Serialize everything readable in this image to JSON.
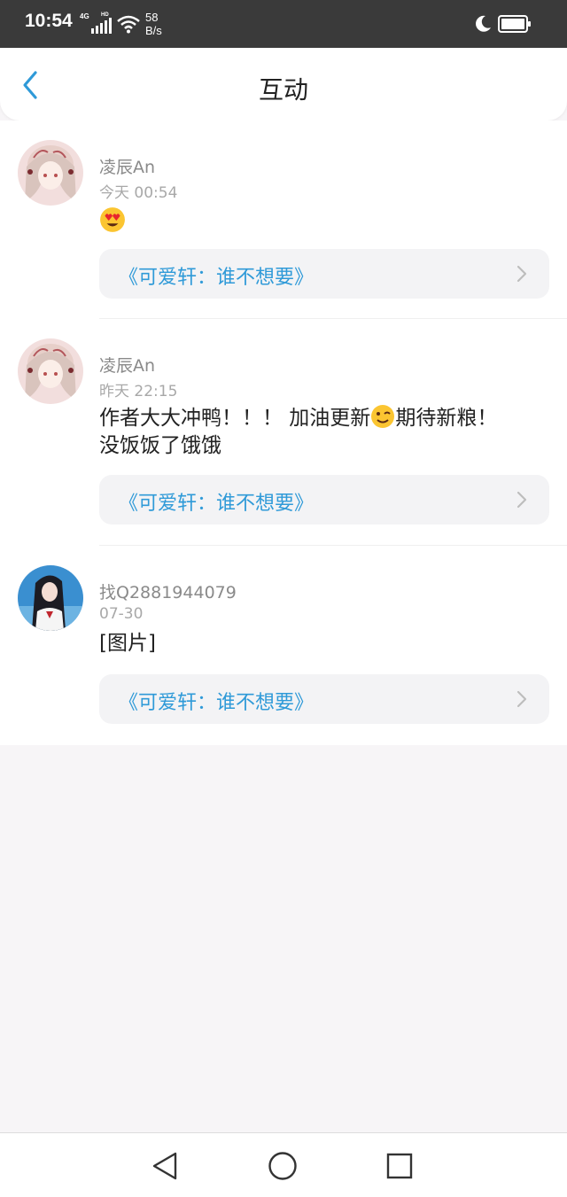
{
  "status_bar": {
    "time": "10:54",
    "network": "4G",
    "hd": "HD",
    "speed_value": "58",
    "speed_unit": "B/s"
  },
  "header": {
    "title": "互动"
  },
  "interactions": [
    {
      "username": "凌辰An",
      "time": "今天 00:54",
      "content_emoji": "heart-eyes-emoji",
      "work_title": "《可爱轩：谁不想要》"
    },
    {
      "username": "凌辰An",
      "time": "昨天 22:15",
      "content_line1_a": "作者大大冲鸭！！！ 加油更新",
      "content_emoji": "wink-emoji",
      "content_line1_b": "期待新粮！",
      "content_line2": "没饭饭了饿饿",
      "work_title": "《可爱轩：谁不想要》"
    },
    {
      "username": "找Q2881944079",
      "time": "07-30",
      "content": "[图片]",
      "work_title": "《可爱轩：谁不想要》"
    }
  ],
  "colors": {
    "accent": "#2f9ad8",
    "status_bar_bg": "#3a3a3a",
    "page_bg": "#f7f5f7"
  }
}
